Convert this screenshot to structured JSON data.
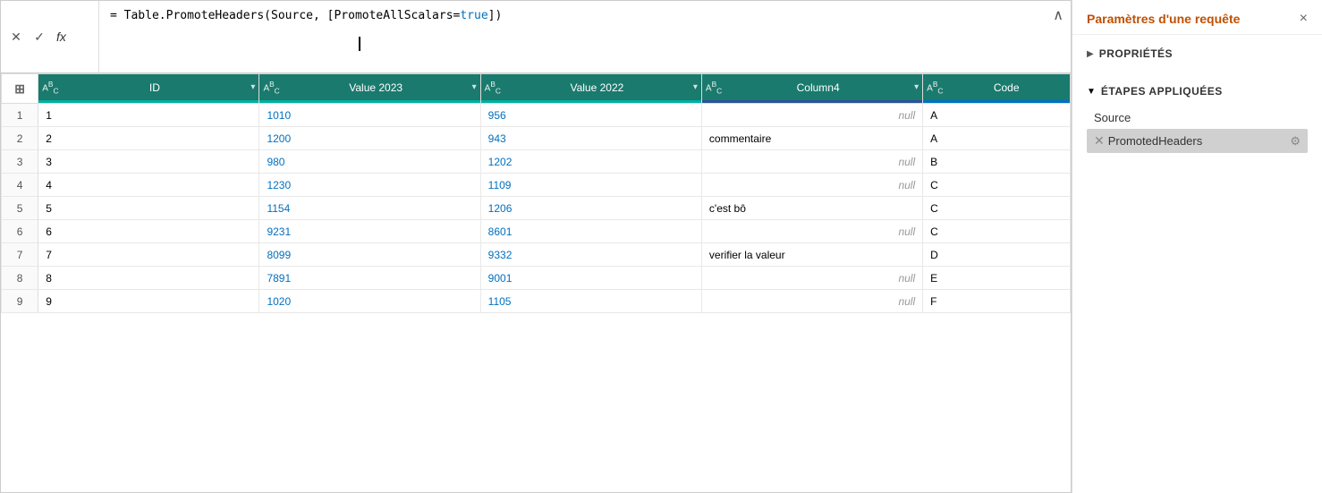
{
  "formula_bar": {
    "formula_text": "= Table.PromoteHeaders(Source, [PromoteAllScalars=true])",
    "formula_keyword": "= Table.PromoteHeaders(",
    "formula_arg1": "Source",
    "formula_arg2": ", [PromoteAllScalars=",
    "formula_value": "true",
    "formula_close": "])"
  },
  "icons": {
    "close_x": "✕",
    "check": "✓",
    "fx": "fx",
    "collapse": "∧",
    "table_icon": "⊞",
    "filter": "▾",
    "delete_x": "✕",
    "settings_gear": "⚙",
    "arrow_right": "▶",
    "arrow_down": "▲"
  },
  "columns": [
    {
      "id": "row_num",
      "label": "",
      "type": ""
    },
    {
      "id": "id",
      "label": "ID",
      "type": "ABC",
      "style": "teal"
    },
    {
      "id": "value2023",
      "label": "Value 2023",
      "type": "ABC",
      "style": "teal"
    },
    {
      "id": "value2022",
      "label": "Value 2022",
      "type": "ABC",
      "style": "teal"
    },
    {
      "id": "column4",
      "label": "Column4",
      "type": "ABC",
      "style": "dark"
    },
    {
      "id": "code",
      "label": "Code",
      "type": "ABC",
      "style": "blue"
    }
  ],
  "rows": [
    {
      "num": 1,
      "id": "1",
      "v2023": "1010",
      "v2022": "956",
      "col4": null,
      "code": "A"
    },
    {
      "num": 2,
      "id": "2",
      "v2023": "1200",
      "v2022": "943",
      "col4": "commentaire",
      "code": "A"
    },
    {
      "num": 3,
      "id": "3",
      "v2023": "980",
      "v2022": "1202",
      "col4": null,
      "code": "B"
    },
    {
      "num": 4,
      "id": "4",
      "v2023": "1230",
      "v2022": "1109",
      "col4": null,
      "code": "C"
    },
    {
      "num": 5,
      "id": "5",
      "v2023": "1154",
      "v2022": "1206",
      "col4": "c'est bô",
      "code": "C"
    },
    {
      "num": 6,
      "id": "6",
      "v2023": "9231",
      "v2022": "8601",
      "col4": null,
      "code": "C"
    },
    {
      "num": 7,
      "id": "7",
      "v2023": "8099",
      "v2022": "9332",
      "col4": "verifier la valeur",
      "code": "D"
    },
    {
      "num": 8,
      "id": "8",
      "v2023": "7891",
      "v2022": "9001",
      "col4": null,
      "code": "E"
    },
    {
      "num": 9,
      "id": "9",
      "v2023": "1020",
      "v2022": "1105",
      "col4": null,
      "code": "F"
    }
  ],
  "panel": {
    "title": "Paramètres d'une requête",
    "close_label": "×",
    "proprietes_label": "PROPRIÉTÉS",
    "etapes_label": "ÉTAPES APPLIQUÉES",
    "steps": [
      {
        "id": "source",
        "label": "Source",
        "active": false,
        "deletable": false,
        "has_settings": false
      },
      {
        "id": "promoted_headers",
        "label": "PromotedHeaders",
        "active": true,
        "deletable": true,
        "has_settings": true
      }
    ]
  }
}
